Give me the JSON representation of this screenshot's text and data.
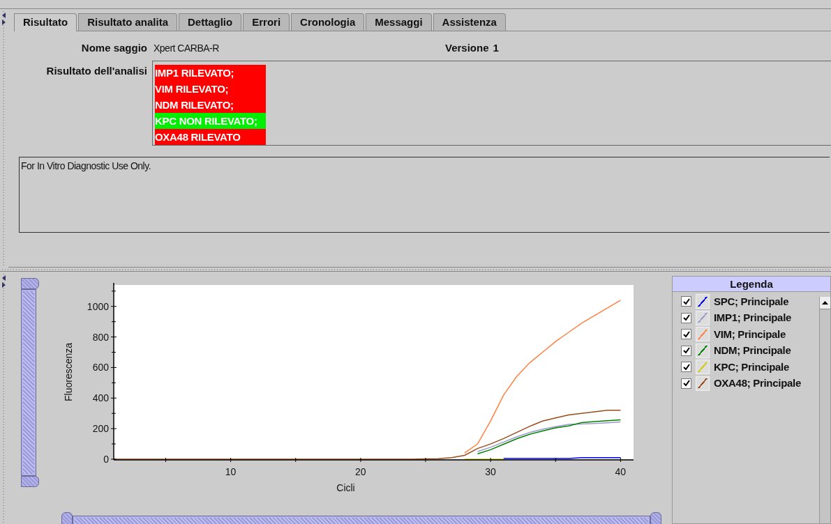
{
  "tabs": [
    {
      "label": "Risultato",
      "selected": true
    },
    {
      "label": "Risultato analita",
      "selected": false
    },
    {
      "label": "Dettaglio",
      "selected": false
    },
    {
      "label": "Errori",
      "selected": false
    },
    {
      "label": "Cronologia",
      "selected": false
    },
    {
      "label": "Messaggi",
      "selected": false
    },
    {
      "label": "Assistenza",
      "selected": false
    }
  ],
  "assay": {
    "label": "Nome saggio",
    "value": "Xpert CARBA-R"
  },
  "version": {
    "label": "Versione",
    "value": "1"
  },
  "result": {
    "label": "Risultato dell'analisi",
    "lines": [
      {
        "text": "IMP1 RILEVATO;",
        "color": "#ff0000"
      },
      {
        "text": "VIM RILEVATO;",
        "color": "#ff0000"
      },
      {
        "text": "NDM RILEVATO;",
        "color": "#ff0000"
      },
      {
        "text": "KPC NON RILEVATO;",
        "color": "#00ee00"
      },
      {
        "text": "OXA48 RILEVATO",
        "color": "#ff0000"
      }
    ]
  },
  "note": "For In Vitro Diagnostic Use Only.",
  "chart_data": {
    "type": "line",
    "xlabel": "Cicli",
    "ylabel": "Fluorescenza",
    "xlim": [
      1,
      41
    ],
    "ylim": [
      0,
      1140
    ],
    "xticks": [
      10,
      20,
      30,
      40
    ],
    "yticks": [
      0,
      200,
      400,
      600,
      800,
      1000
    ],
    "x": [
      1,
      2,
      3,
      4,
      5,
      6,
      7,
      8,
      9,
      10,
      11,
      12,
      13,
      14,
      15,
      16,
      17,
      18,
      19,
      20,
      21,
      22,
      23,
      24,
      25,
      26,
      27,
      28,
      29,
      30,
      31,
      32,
      33,
      34,
      35,
      36,
      37,
      38,
      39,
      40
    ],
    "series": [
      {
        "color": "#0000ff",
        "values": [
          null,
          null,
          null,
          null,
          null,
          null,
          null,
          null,
          null,
          null,
          null,
          null,
          null,
          null,
          null,
          null,
          null,
          null,
          null,
          null,
          null,
          null,
          null,
          null,
          null,
          null,
          null,
          null,
          null,
          null,
          5,
          5,
          5,
          5,
          5,
          5,
          10,
          10,
          10,
          10
        ]
      },
      {
        "color": "#9999cc",
        "values": [
          null,
          null,
          null,
          null,
          null,
          null,
          null,
          null,
          null,
          null,
          null,
          null,
          null,
          null,
          null,
          null,
          null,
          null,
          null,
          null,
          null,
          null,
          null,
          null,
          null,
          null,
          null,
          null,
          50,
          78,
          112,
          146,
          175,
          196,
          213,
          228,
          230,
          234,
          238,
          244
        ]
      },
      {
        "color": "#ff8040",
        "values": [
          null,
          null,
          null,
          null,
          null,
          null,
          null,
          null,
          null,
          null,
          null,
          null,
          null,
          null,
          null,
          null,
          null,
          null,
          null,
          null,
          null,
          null,
          null,
          null,
          null,
          null,
          null,
          40,
          100,
          250,
          420,
          540,
          630,
          700,
          770,
          830,
          890,
          940,
          990,
          1040
        ]
      },
      {
        "color": "#008000",
        "values": [
          null,
          null,
          null,
          null,
          null,
          null,
          null,
          null,
          null,
          null,
          null,
          null,
          null,
          null,
          null,
          null,
          null,
          null,
          null,
          null,
          null,
          null,
          null,
          null,
          null,
          null,
          null,
          null,
          35,
          62,
          98,
          133,
          163,
          185,
          205,
          218,
          240,
          246,
          252,
          258
        ]
      },
      {
        "color": "#cccc00",
        "values": [
          null,
          null,
          null,
          null,
          null,
          null,
          null,
          null,
          null,
          null,
          null,
          null,
          null,
          null,
          null,
          null,
          null,
          null,
          null,
          null,
          null,
          null,
          null,
          null,
          null,
          null,
          null,
          0,
          0,
          0,
          0,
          null,
          null,
          null,
          null,
          null,
          null,
          null,
          null,
          null
        ]
      },
      {
        "color": "#994c1a",
        "values": [
          0,
          0,
          0,
          0,
          0,
          0,
          0,
          0,
          0,
          0,
          0,
          0,
          0,
          0,
          0,
          0,
          0,
          0,
          0,
          0,
          0,
          0,
          0,
          0,
          2,
          3,
          10,
          25,
          70,
          100,
          135,
          175,
          215,
          250,
          270,
          290,
          300,
          310,
          320,
          320
        ]
      }
    ]
  },
  "y_range": {
    "level": 1
  },
  "x_range": {
    "level": 1
  },
  "legend": {
    "title": "Legenda",
    "items": [
      {
        "label": "SPC; Principale",
        "checked": true,
        "color": "#0000ff"
      },
      {
        "label": "IMP1; Principale",
        "checked": true,
        "color": "#9999cc"
      },
      {
        "label": "VIM; Principale",
        "checked": true,
        "color": "#ff8040"
      },
      {
        "label": "NDM; Principale",
        "checked": true,
        "color": "#008000"
      },
      {
        "label": "KPC; Principale",
        "checked": true,
        "color": "#cccc00"
      },
      {
        "label": "OXA48; Principale",
        "checked": true,
        "color": "#994c1a"
      }
    ]
  }
}
